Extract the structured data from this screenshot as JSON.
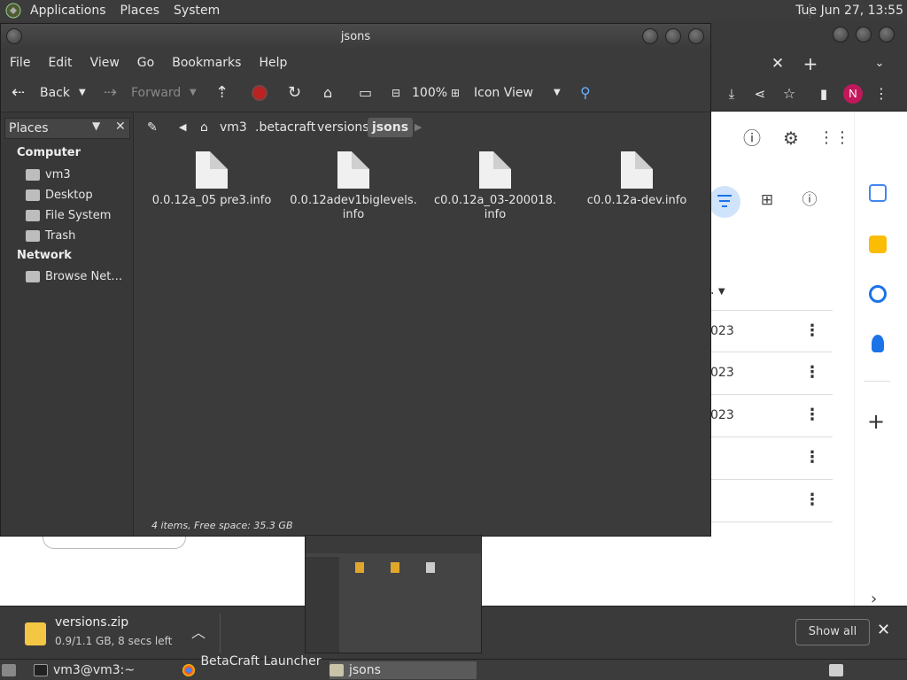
{
  "top_panel": {
    "menus": [
      "Applications",
      "Places",
      "System"
    ],
    "clock": "Tue Jun 27, 13:55"
  },
  "browser": {
    "avatar_letter": "N",
    "rows": [
      {
        "date": "023"
      },
      {
        "date": "023"
      },
      {
        "date": "023"
      },
      {
        "date": ""
      },
      {
        "date": ""
      }
    ],
    "sort_label": "."
  },
  "file_manager": {
    "title": "jsons",
    "menus": [
      "File",
      "Edit",
      "View",
      "Go",
      "Bookmarks",
      "Help"
    ],
    "toolbar": {
      "back": "Back",
      "forward": "Forward",
      "zoom": "100%",
      "view_mode": "Icon View"
    },
    "sidebar": {
      "header": "Places",
      "sections": [
        {
          "title": "Computer",
          "items": [
            "vm3",
            "Desktop",
            "File System",
            "Trash"
          ]
        },
        {
          "title": "Network",
          "items": [
            "Browse Net…"
          ]
        }
      ]
    },
    "breadcrumbs": [
      "vm3",
      ".betacraft",
      "versions",
      "jsons"
    ],
    "files": [
      {
        "name": "0.0.12a_05 pre3.info"
      },
      {
        "name": "0.0.12adev1biglevels.\ninfo"
      },
      {
        "name": "c0.0.12a_03-200018.\ninfo"
      },
      {
        "name": "c0.0.12a-dev.info"
      }
    ],
    "status": "4 items, Free space: 35.3 GB"
  },
  "download_bar": {
    "file_name": "versions.zip",
    "status": "0.9/1.1 GB, 8 secs left",
    "show_all": "Show all"
  },
  "taskbar": {
    "tasks": [
      "vm3@vm3:~",
      "BetaCraft Launcher …",
      "jsons"
    ]
  },
  "colors": {
    "accent_avatar": "#c2185b",
    "panel": "#3c3c3c",
    "window": "#3b3b3b"
  }
}
